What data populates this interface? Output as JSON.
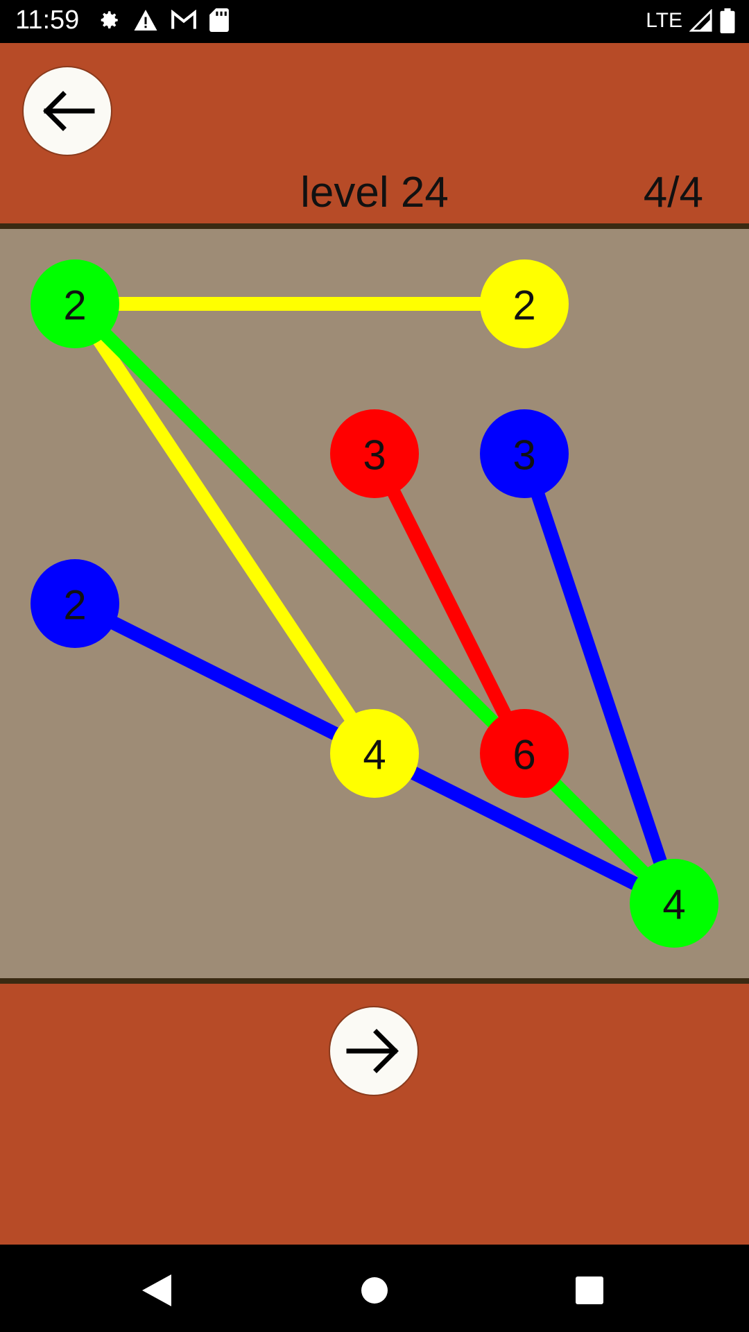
{
  "status_bar": {
    "time": "11:59",
    "network": "LTE",
    "icons": [
      "gear-icon",
      "warning-icon",
      "gmail-icon",
      "sd-card-icon",
      "signal-icon",
      "battery-icon"
    ]
  },
  "header": {
    "level_title": "level 24",
    "progress": "4/4",
    "back_icon": "arrow-left-icon"
  },
  "footer": {
    "next_icon": "arrow-right-icon"
  },
  "colors": {
    "header_bg": "#b74b27",
    "board_bg": "#9e8c76",
    "green": "#00ff00",
    "yellow": "#ffff00",
    "red": "#ff0000",
    "blue": "#0000ff"
  },
  "board": {
    "nodes": [
      {
        "id": "n1",
        "label": "2",
        "color": "#00ff00",
        "col": 0,
        "row": 0
      },
      {
        "id": "n2",
        "label": "2",
        "color": "#ffff00",
        "col": 3,
        "row": 0
      },
      {
        "id": "n3",
        "label": "3",
        "color": "#ff0000",
        "col": 2,
        "row": 1
      },
      {
        "id": "n4",
        "label": "3",
        "color": "#0000ff",
        "col": 3,
        "row": 1
      },
      {
        "id": "n5",
        "label": "2",
        "color": "#0000ff",
        "col": 0,
        "row": 2
      },
      {
        "id": "n6",
        "label": "4",
        "color": "#ffff00",
        "col": 2,
        "row": 3
      },
      {
        "id": "n7",
        "label": "6",
        "color": "#ff0000",
        "col": 3,
        "row": 3
      },
      {
        "id": "n8",
        "label": "4",
        "color": "#00ff00",
        "col": 4,
        "row": 4
      }
    ],
    "edges": [
      {
        "from": "n1",
        "to": "n2",
        "color": "#ffff00"
      },
      {
        "from": "n1",
        "to": "n6",
        "color": "#ffff00"
      },
      {
        "from": "n1",
        "to": "n8",
        "color": "#00ff00"
      },
      {
        "from": "n3",
        "to": "n7",
        "color": "#ff0000"
      },
      {
        "from": "n4",
        "to": "n8",
        "color": "#0000ff"
      },
      {
        "from": "n5",
        "to": "n6",
        "color": "#0000ff"
      },
      {
        "from": "n6",
        "to": "n8",
        "color": "#0000ff"
      }
    ]
  },
  "nav": {
    "back": "nav-back-icon",
    "home": "nav-home-icon",
    "recents": "nav-recents-icon"
  }
}
